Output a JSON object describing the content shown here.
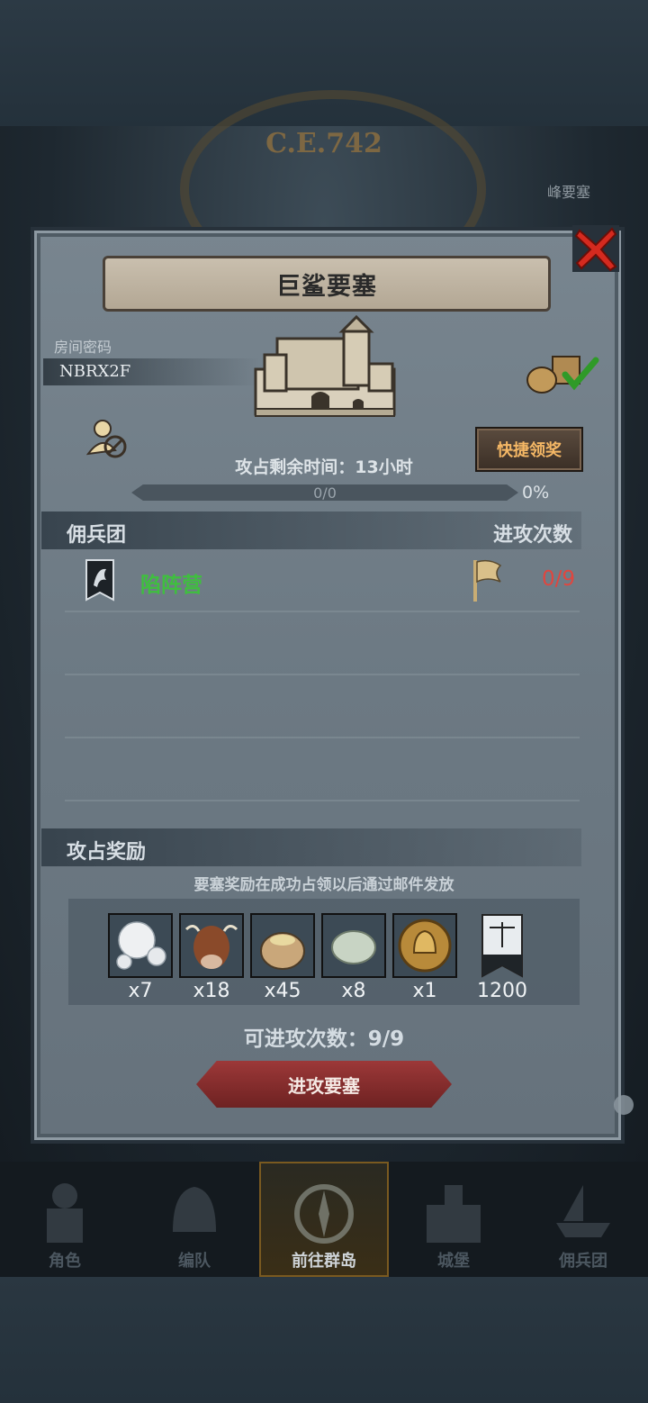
{
  "background": {
    "era": "C.E.742",
    "side_label": "峰要塞"
  },
  "panel": {
    "title": "巨鲨要塞",
    "room_label": "房间密码",
    "room_code": "NBRX2F",
    "quick_claim_label": "快捷领奖",
    "remaining_time": "攻占剩余时间：13小时",
    "progress": {
      "text": "0/0",
      "percent_label": "0%",
      "fraction": 0
    },
    "mercenary_header": "佣兵团",
    "attack_count_header": "进攻次数",
    "mercenaries": [
      {
        "name": "陷阵营",
        "attacks": "0/9"
      }
    ],
    "rewards_header": "攻占奖励",
    "rewards_note": "要塞奖励在成功占领以后通过邮件发放",
    "rewards": [
      {
        "icon": "pearl-icon",
        "qty": "x7"
      },
      {
        "icon": "cattle-icon",
        "qty": "x18"
      },
      {
        "icon": "grain-sack-icon",
        "qty": "x45"
      },
      {
        "icon": "stone-icon",
        "qty": "x8"
      },
      {
        "icon": "knight-coin-icon",
        "qty": "x1"
      },
      {
        "icon": "justice-banner-icon",
        "qty": "1200"
      }
    ],
    "available_attacks": "可进攻次数：9/9",
    "attack_button_label": "进攻要塞"
  },
  "nav": {
    "items": [
      {
        "label": "角色",
        "icon": "knight-icon"
      },
      {
        "label": "编队",
        "icon": "helmet-icon"
      },
      {
        "label": "前往群岛",
        "icon": "compass-icon"
      },
      {
        "label": "城堡",
        "icon": "castle-icon"
      },
      {
        "label": "佣兵团",
        "icon": "mercenary-ship-icon"
      }
    ]
  },
  "colors": {
    "merc_name": "#3fbf3f",
    "attack_count": "#e0463f",
    "quick_claim_text": "#f4b765",
    "attack_button": "#8a2d2d",
    "close_x": "#d42a1f"
  }
}
